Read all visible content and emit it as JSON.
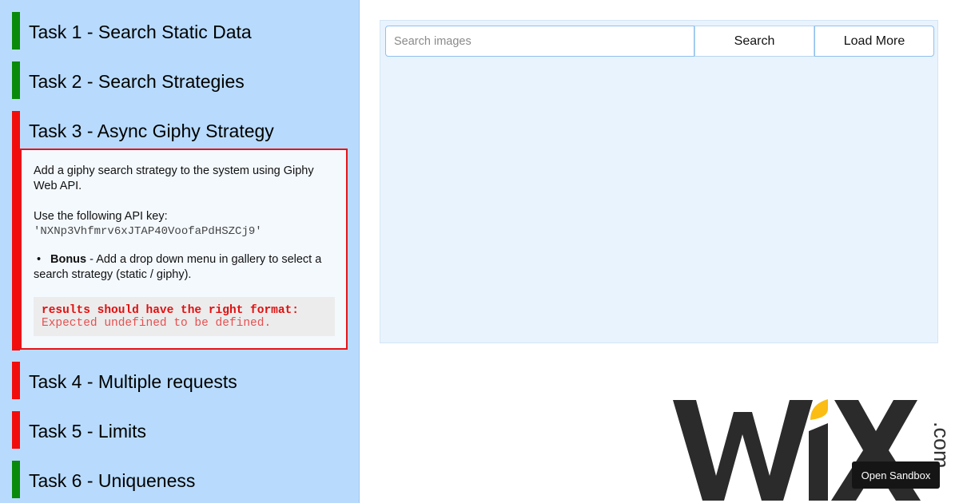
{
  "sidebar": {
    "tasks": [
      {
        "title": "Task 1 - Search Static Data",
        "status": "pass",
        "color": "#0a8a0a"
      },
      {
        "title": "Task 2 - Search Strategies",
        "status": "pass",
        "color": "#0a8a0a"
      },
      {
        "title": "Task 3 - Async Giphy Strategy",
        "status": "fail",
        "color": "#f20d0d"
      },
      {
        "title": "Task 4 - Multiple requests",
        "status": "fail",
        "color": "#f20d0d"
      },
      {
        "title": "Task 5 - Limits",
        "status": "fail",
        "color": "#f20d0d"
      },
      {
        "title": "Task 6 - Uniqueness",
        "status": "pass",
        "color": "#0a8a0a"
      }
    ],
    "open_task": {
      "description": "Add a giphy search strategy to the system using Giphy Web API.",
      "api_label": "Use the following API key:",
      "api_key": "'NXNp3Vhfmrv6xJTAP40VoofaPdHSZCj9'",
      "bonus_label": "Bonus",
      "bonus_text": " - Add a drop down menu in gallery to select a search strategy (static / giphy).",
      "error_title": "results should have the right format:",
      "error_message": "Expected undefined to be defined."
    }
  },
  "gallery": {
    "search_placeholder": "Search images",
    "search_value": "",
    "search_button": "Search",
    "load_more_button": "Load More"
  },
  "logo": {
    "brand": "WIX",
    "suffix": ".com",
    "accent_color": "#fbbd14"
  },
  "sandbox": {
    "label": "Open Sandbox"
  }
}
